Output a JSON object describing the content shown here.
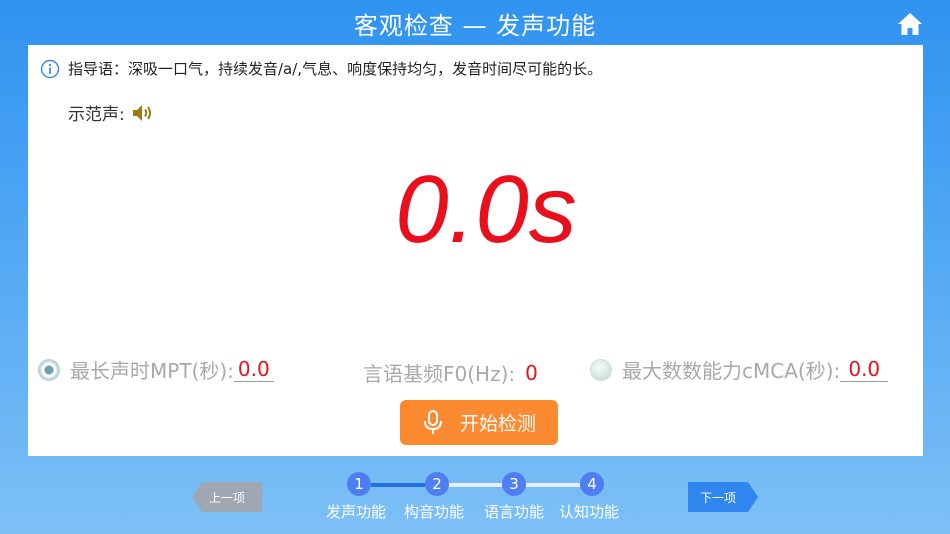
{
  "header": {
    "title": "客观检查 — 发声功能",
    "home_icon": "home-icon"
  },
  "instructions": {
    "icon": "info-icon",
    "text": "指导语：深吸一口气，持续发音/a/,气息、响度保持均匀，发音时间尽可能的长。"
  },
  "demo": {
    "label": "示范声:",
    "icon": "speaker-icon"
  },
  "timer": {
    "value": "0.0s"
  },
  "metrics": [
    {
      "label": "最长声时MPT(秒):",
      "value": "0.0",
      "selected": true
    },
    {
      "label": "言语基频F0(Hz):",
      "value": "0"
    },
    {
      "label": "最大数数能力cMCA(秒):",
      "value": "0.0",
      "selected": false
    }
  ],
  "start_button": {
    "label": "开始检测",
    "icon": "microphone-icon"
  },
  "nav": {
    "prev_label": "上一项",
    "next_label": "下一项"
  },
  "steps": [
    {
      "number": "1",
      "label": "发声功能"
    },
    {
      "number": "2",
      "label": "构音功能"
    },
    {
      "number": "3",
      "label": "语言功能"
    },
    {
      "number": "4",
      "label": "认知功能"
    }
  ],
  "colors": {
    "accent_red": "#e8101c",
    "button_orange": "#fb8a30",
    "step_blue": "#4f7df2"
  }
}
